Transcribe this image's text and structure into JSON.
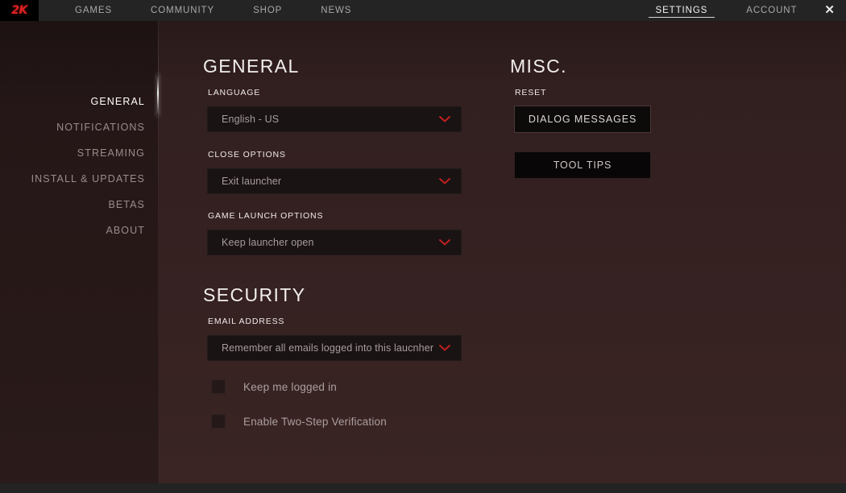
{
  "topbar": {
    "logo": "2K",
    "logo_icon": "2k-logo",
    "left_nav": [
      {
        "label": "GAMES",
        "active": false
      },
      {
        "label": "COMMUNITY",
        "active": false
      },
      {
        "label": "SHOP",
        "active": false
      },
      {
        "label": "NEWS",
        "active": false
      }
    ],
    "right_nav": [
      {
        "label": "SETTINGS",
        "active": true
      },
      {
        "label": "ACCOUNT",
        "active": false
      }
    ],
    "close_label": "✕",
    "close_icon": "close-icon"
  },
  "sidebar": {
    "items": [
      {
        "label": "GENERAL",
        "active": true
      },
      {
        "label": "NOTIFICATIONS",
        "active": false
      },
      {
        "label": "STREAMING",
        "active": false
      },
      {
        "label": "INSTALL & UPDATES",
        "active": false
      },
      {
        "label": "BETAS",
        "active": false
      },
      {
        "label": "ABOUT",
        "active": false
      }
    ]
  },
  "general": {
    "title": "GENERAL",
    "language": {
      "label": "LANGUAGE",
      "value": "English - US",
      "chevron_icon": "chevron-down-icon"
    },
    "close_options": {
      "label": "CLOSE OPTIONS",
      "value": "Exit launcher",
      "chevron_icon": "chevron-down-icon"
    },
    "game_launch_options": {
      "label": "GAME LAUNCH OPTIONS",
      "value": "Keep launcher open",
      "chevron_icon": "chevron-down-icon"
    }
  },
  "security": {
    "title": "SECURITY",
    "email_address": {
      "label": "EMAIL ADDRESS",
      "value": "Remember all emails logged into this laucnher",
      "chevron_icon": "chevron-down-icon"
    },
    "checkboxes": [
      {
        "label": "Keep me logged in",
        "checked": false
      },
      {
        "label": "Enable Two-Step Verification",
        "checked": false
      }
    ]
  },
  "misc": {
    "title": "MISC.",
    "reset_label": "RESET",
    "buttons": [
      {
        "label": "DIALOG MESSAGES",
        "hovered": true
      },
      {
        "label": "TOOL TIPS",
        "hovered": false
      }
    ]
  },
  "colors": {
    "accent_red": "#c21f1f",
    "logo_red": "#e02020",
    "background": "#321f1f",
    "panel_dark": "#191313",
    "button_black": "#080606",
    "topbar": "#242424",
    "bottombar": "#232323"
  }
}
